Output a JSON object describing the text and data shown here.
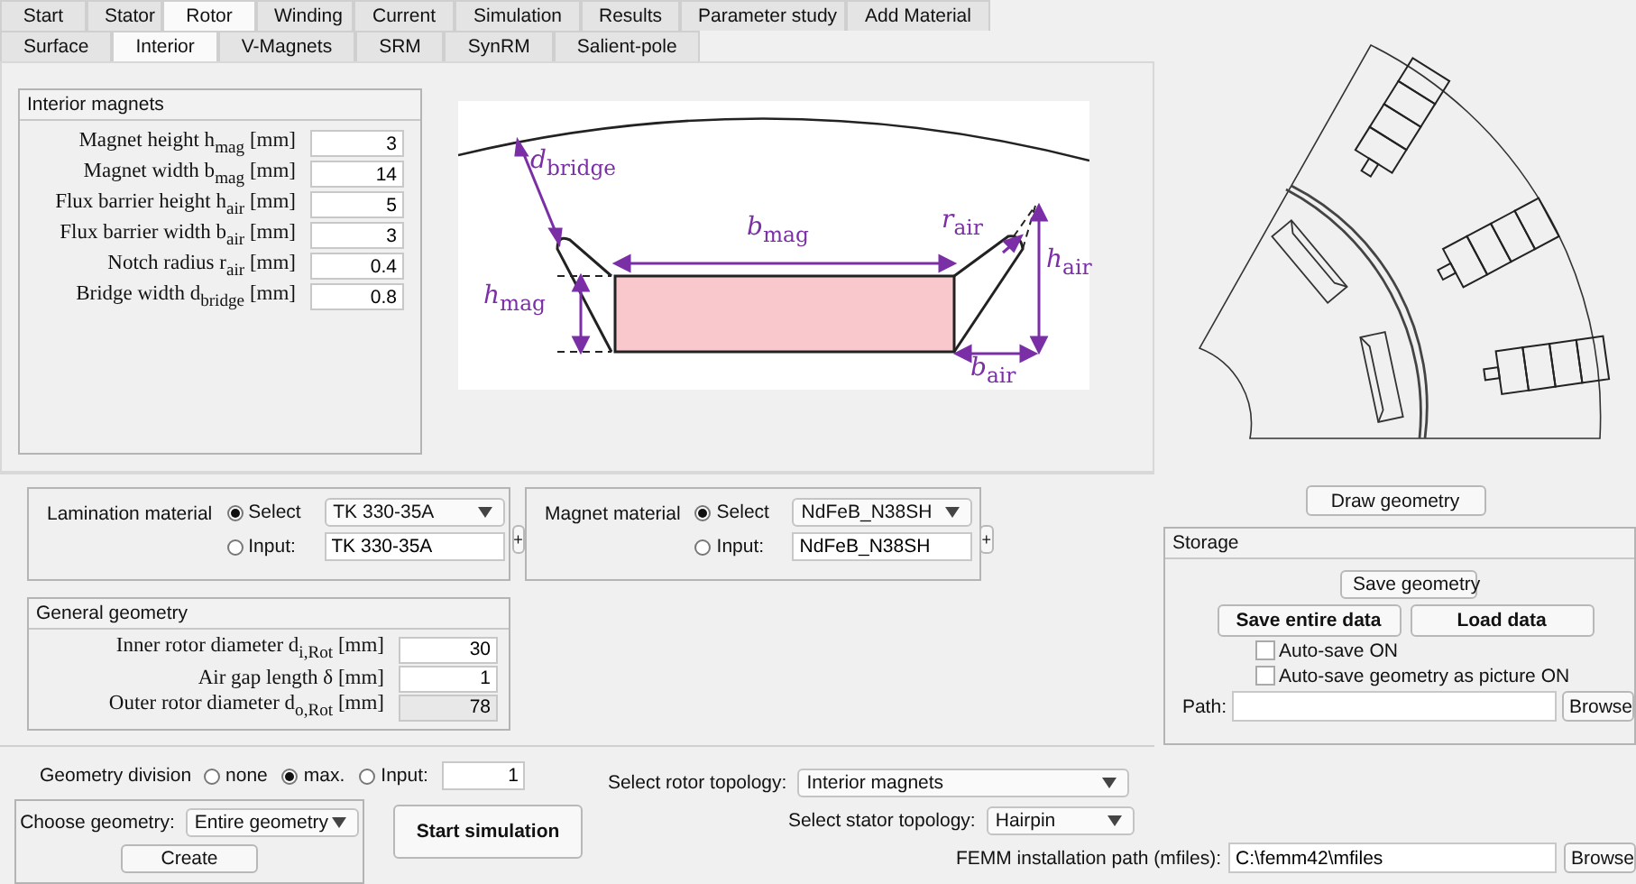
{
  "tabs": [
    {
      "label": "Start",
      "selected": false
    },
    {
      "label": "Stator",
      "selected": false
    },
    {
      "label": "Rotor",
      "selected": true
    },
    {
      "label": "Winding",
      "selected": false
    },
    {
      "label": "Current",
      "selected": false
    },
    {
      "label": "Simulation",
      "selected": false
    },
    {
      "label": "Results",
      "selected": false
    },
    {
      "label": "Parameter study",
      "selected": false
    },
    {
      "label": "Add Material",
      "selected": false
    }
  ],
  "subtabs": [
    {
      "label": "Surface",
      "selected": false
    },
    {
      "label": "Interior",
      "selected": true
    },
    {
      "label": "V-Magnets",
      "selected": false
    },
    {
      "label": "SRM",
      "selected": false
    },
    {
      "label": "SynRM",
      "selected": false
    },
    {
      "label": "Salient-pole",
      "selected": false
    }
  ],
  "interior_magnets": {
    "title": "Interior magnets",
    "params": [
      {
        "label": "Magnet height h$_{mag}$ [mm]",
        "value": "3"
      },
      {
        "label": "Magnet width b$_{mag}$ [mm]",
        "value": "14"
      },
      {
        "label": "Flux barrier height h$_{air}$ [mm]",
        "value": "5"
      },
      {
        "label": "Flux barrier width b$_{air}$ [mm]",
        "value": "3"
      },
      {
        "label": "Notch radius r$_{air}$ [mm]",
        "value": "0.4"
      },
      {
        "label": "Bridge width d$_{bridge}$ [mm]",
        "value": "0.8"
      }
    ]
  },
  "diagram": {
    "labels": [
      "*d*$_{bridge}$",
      "*b*$_{mag}$",
      "*r*$_{air}$",
      "*h*$_{air}$",
      "*h*$_{mag}$",
      "*b*$_{air}$"
    ]
  },
  "draw_geometry_button": "Draw geometry",
  "lamination_material": {
    "label": "Lamination material",
    "options": [
      {
        "label": "Select",
        "selected": true,
        "kind": "dropdown",
        "value": "TK 330-35A"
      },
      {
        "label": "Input:",
        "selected": false,
        "kind": "text",
        "value": "TK 330-35A"
      }
    ],
    "add_button": "+"
  },
  "magnet_material": {
    "label": "Magnet material",
    "options": [
      {
        "label": "Select",
        "selected": true,
        "kind": "dropdown",
        "value": "NdFeB_N38SH"
      },
      {
        "label": "Input:",
        "selected": false,
        "kind": "text",
        "value": "NdFeB_N38SH"
      }
    ],
    "add_button": "+"
  },
  "general_geometry": {
    "title": "General geometry",
    "params": [
      {
        "label": "Inner rotor diameter d$_{i,Rot}$ [mm]",
        "value": "30",
        "readonly": false
      },
      {
        "label": "Air gap length δ [mm]",
        "value": "1",
        "readonly": false
      },
      {
        "label": "Outer rotor diameter d$_{o,Rot}$ [mm]",
        "value": "78",
        "readonly": true
      }
    ]
  },
  "storage": {
    "title": "Storage",
    "save_geometry_button": "Save geometry",
    "save_entire_data_button": "Save entire data",
    "load_data_button": "Load data",
    "checkboxes": [
      {
        "label": "Auto-save ON",
        "checked": false
      },
      {
        "label": "Auto-save geometry as picture ON",
        "checked": false
      }
    ],
    "path_label": "Path:",
    "browse_button": "Browse"
  },
  "geometry_division": {
    "label": "Geometry division",
    "options": [
      {
        "label": "none",
        "selected": false
      },
      {
        "label": "max.",
        "selected": true
      },
      {
        "label": "Input:",
        "selected": false
      }
    ],
    "value": "1"
  },
  "choose_geometry": {
    "label": "Choose geometry:",
    "value": "Entire geometry",
    "button": "Create"
  },
  "start_simulation_button": "Start simulation",
  "rotor_topology": {
    "label": "Select rotor topology:",
    "value": "Interior magnets"
  },
  "stator_topology": {
    "label": "Select stator topology:",
    "value": "Hairpin"
  },
  "femm_path": {
    "label": "FEMM installation path (mfiles):",
    "value": "C:\\femm42\\mfiles",
    "button": "Browse"
  }
}
